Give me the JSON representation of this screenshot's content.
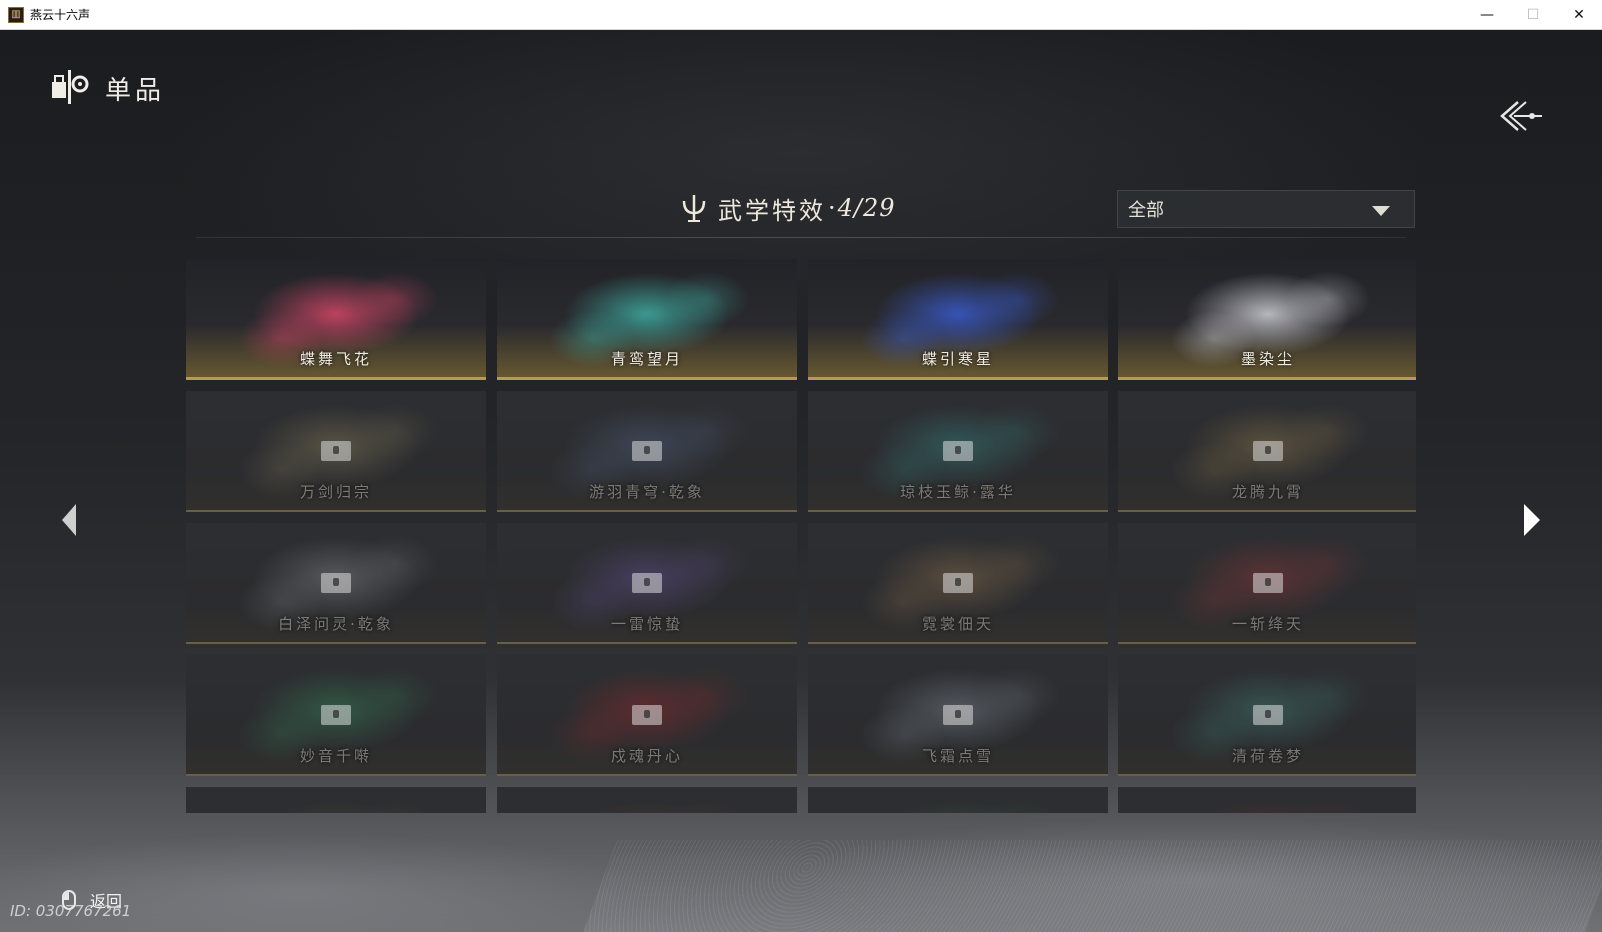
{
  "window": {
    "title": "燕云十六声",
    "minimize": "—",
    "maximize": "☐",
    "close": "✕"
  },
  "header": {
    "title": "单品"
  },
  "section": {
    "title": "武学特效",
    "separator": "·",
    "count": "4/29"
  },
  "filter": {
    "selected": "全部"
  },
  "cards": [
    {
      "label": "蝶舞飞花",
      "locked": false,
      "accent": "#e0486a"
    },
    {
      "label": "青鸾望月",
      "locked": false,
      "accent": "#3fb5a8"
    },
    {
      "label": "蝶引寒星",
      "locked": false,
      "accent": "#3a5ed8"
    },
    {
      "label": "墨染尘",
      "locked": false,
      "accent": "#d8d8e0"
    },
    {
      "label": "万剑归宗",
      "locked": true,
      "accent": "#c9b57a"
    },
    {
      "label": "游羽青穹·乾象",
      "locked": true,
      "accent": "#6a86b8"
    },
    {
      "label": "琼枝玉鲸·露华",
      "locked": true,
      "accent": "#3ec4c0"
    },
    {
      "label": "龙腾九霄",
      "locked": true,
      "accent": "#d4b060"
    },
    {
      "label": "白泽问灵·乾象",
      "locked": true,
      "accent": "#c8c8d0"
    },
    {
      "label": "一雷惊蛰",
      "locked": true,
      "accent": "#8a6ad8"
    },
    {
      "label": "霓裳佃天",
      "locked": true,
      "accent": "#d4a060"
    },
    {
      "label": "一斩绛天",
      "locked": true,
      "accent": "#d84040"
    },
    {
      "label": "妙音千啭",
      "locked": true,
      "accent": "#3ec47a"
    },
    {
      "label": "戍魂丹心",
      "locked": true,
      "accent": "#e02a2a"
    },
    {
      "label": "飞霜点雪",
      "locked": true,
      "accent": "#b8c8d8"
    },
    {
      "label": "清荷卷梦",
      "locked": true,
      "accent": "#50b8a8"
    },
    {
      "label": "",
      "locked": true,
      "accent": "#8a7a50"
    },
    {
      "label": "",
      "locked": true,
      "accent": "#a05030"
    },
    {
      "label": "",
      "locked": true,
      "accent": "#50a050"
    },
    {
      "label": "",
      "locked": true,
      "accent": "#c03030"
    }
  ],
  "footer": {
    "back_label": "返回",
    "id_text": "ID: 0307767261"
  },
  "icons": {
    "header": "collection-icon",
    "back_top": "back-arrow-icon",
    "section": "trident-icon",
    "filter": "chevron-down-icon",
    "nav_left": "arrow-left-icon",
    "nav_right": "arrow-right-icon",
    "mouse": "mouse-icon"
  }
}
